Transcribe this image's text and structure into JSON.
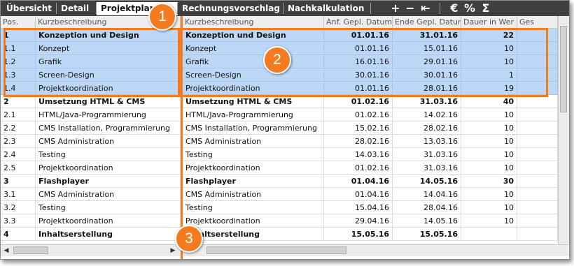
{
  "toolbar": {
    "tabs": [
      "Übersicht",
      "Detail",
      "Projektplan",
      "Rechnungsvorschlag",
      "Nachkalkulation"
    ],
    "icons": [
      {
        "name": "add-icon",
        "glyph": "+"
      },
      {
        "name": "remove-icon",
        "glyph": "−"
      },
      {
        "name": "indent-icon",
        "glyph": "⇤"
      },
      {
        "name": "euro-icon",
        "glyph": "€"
      },
      {
        "name": "percent-icon",
        "glyph": "%"
      },
      {
        "name": "sum-icon",
        "glyph": "Σ"
      }
    ]
  },
  "left_grid": {
    "columns": [
      "Pos.",
      "Kurzbeschreibung"
    ]
  },
  "right_grid": {
    "columns": [
      "Kurzbeschreibung",
      "Anf. Gepl. Datum",
      "Ende Gepl. Datum",
      "Dauer in Wer",
      "Ges"
    ]
  },
  "rows": [
    {
      "pos": "1",
      "desc": "Konzeption und Design",
      "start": "01.01.16",
      "end": "31.01.16",
      "dur": "22",
      "group": true,
      "selected": true
    },
    {
      "pos": "1.1",
      "desc": "Konzept",
      "start": "01.01.16",
      "end": "15.01.16",
      "dur": "10",
      "group": false,
      "selected": true
    },
    {
      "pos": "1.2",
      "desc": "Grafik",
      "start": "16.01.16",
      "end": "29.01.16",
      "dur": "10",
      "group": false,
      "selected": true
    },
    {
      "pos": "1.3",
      "desc": "Screen-Design",
      "start": "30.01.16",
      "end": "30.01.16",
      "dur": "1",
      "group": false,
      "selected": true
    },
    {
      "pos": "1.4",
      "desc": "Projektkoordination",
      "start": "01.01.16",
      "end": "28.01.16",
      "dur": "19",
      "group": false,
      "selected": true
    },
    {
      "pos": "2",
      "desc": "Umsetzung HTML & CMS",
      "start": "01.02.16",
      "end": "31.03.16",
      "dur": "40",
      "group": true,
      "selected": false
    },
    {
      "pos": "2.1",
      "desc": "HTML/Java-Programmierung",
      "start": "01.02.16",
      "end": "14.02.16",
      "dur": "10",
      "group": false,
      "selected": false
    },
    {
      "pos": "2.2",
      "desc": "CMS Installation, Programmierung",
      "start": "15.02.16",
      "end": "28.02.16",
      "dur": "10",
      "group": false,
      "selected": false
    },
    {
      "pos": "2.3",
      "desc": "CMS Administration",
      "start": "28.02.16",
      "end": "13.03.16",
      "dur": "10",
      "group": false,
      "selected": false
    },
    {
      "pos": "2.4",
      "desc": "Testing",
      "start": "14.03.16",
      "end": "31.03.16",
      "dur": "10",
      "group": false,
      "selected": false
    },
    {
      "pos": "2.5",
      "desc": "Projektkoordination",
      "start": "01.02.16",
      "end": "31.03.16",
      "dur": "10",
      "group": false,
      "selected": false
    },
    {
      "pos": "3",
      "desc": "Flashplayer",
      "start": "01.04.16",
      "end": "14.05.16",
      "dur": "30",
      "group": true,
      "selected": false
    },
    {
      "pos": "3.1",
      "desc": "CMS Administration",
      "start": "01.04.16",
      "end": "14.04.16",
      "dur": "10",
      "group": false,
      "selected": false
    },
    {
      "pos": "3.2",
      "desc": "Testing",
      "start": "15.04.16",
      "end": "28.04.16",
      "dur": "10",
      "group": false,
      "selected": false
    },
    {
      "pos": "3.3",
      "desc": "Projektkoordination",
      "start": "29.04.16",
      "end": "14.05.16",
      "dur": "10",
      "group": false,
      "selected": false
    },
    {
      "pos": "4",
      "desc": "Inhaltserstellung",
      "start": "15.05.16",
      "end": "15.05.16",
      "dur": "",
      "group": true,
      "selected": false
    }
  ],
  "callouts": [
    "1",
    "2",
    "3"
  ],
  "colors": {
    "accent": "#f47b20",
    "toolbar": "#3f3f3f",
    "selection": "#bcd8f6"
  }
}
